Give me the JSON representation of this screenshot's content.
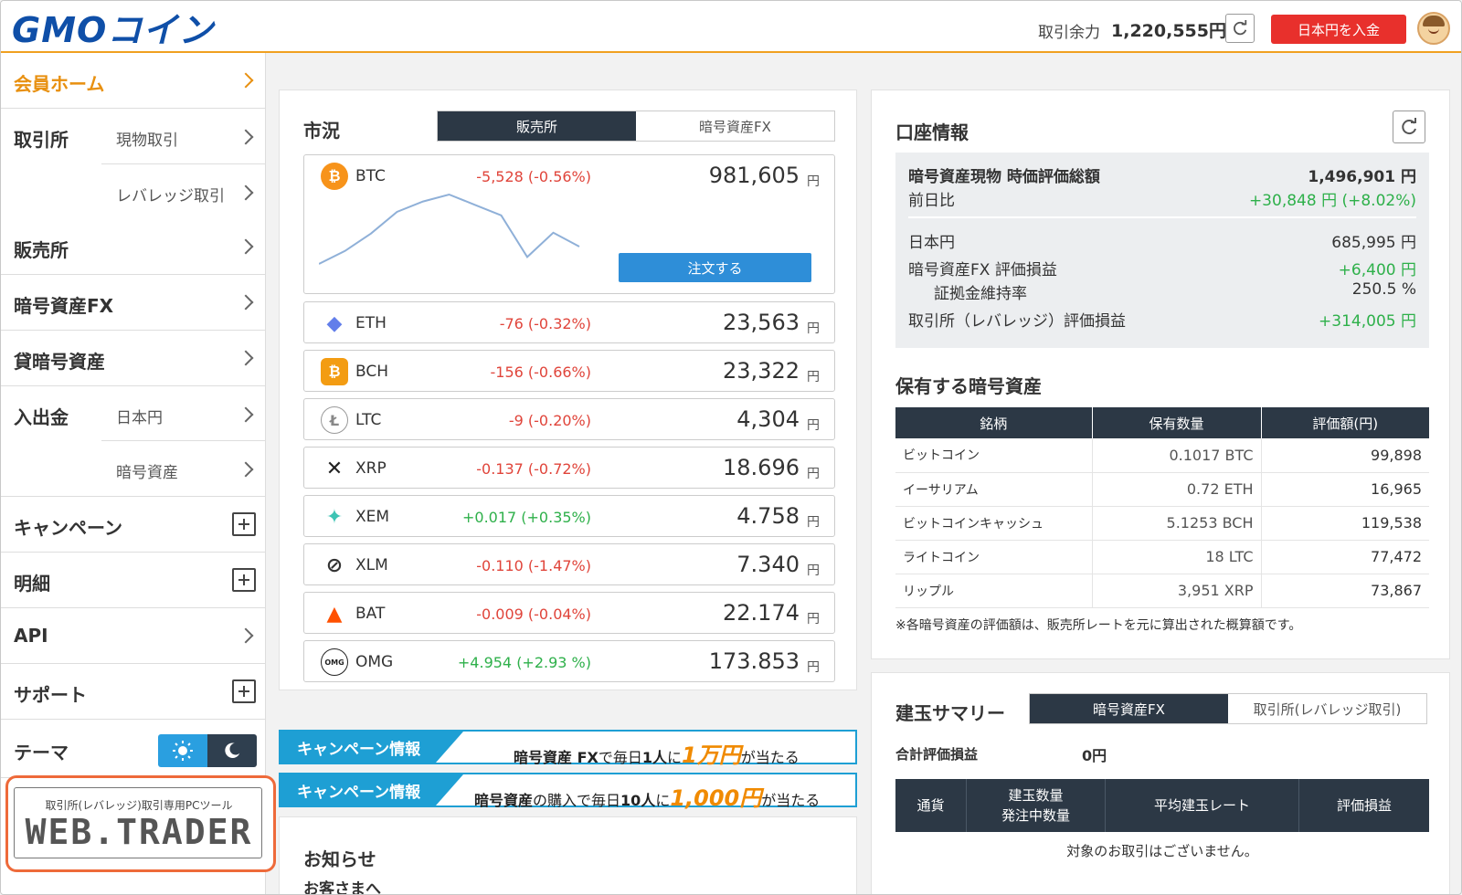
{
  "header": {
    "logo": "GMOコイン",
    "balance_label": "取引余力",
    "balance_value": "1,220,555円",
    "deposit_button": "日本円を入金",
    "accent": "#f0a020",
    "deposit_color": "#e8302c"
  },
  "sidebar": {
    "home": "会員ホーム",
    "exchange": {
      "title": "取引所",
      "sub1": "現物取引",
      "sub2": "レバレッジ取引"
    },
    "dealer": "販売所",
    "fx": "暗号資産FX",
    "lending": "貸暗号資産",
    "transfer": {
      "title": "入出金",
      "sub1": "日本円",
      "sub2": "暗号資産"
    },
    "campaign": "キャンペーン",
    "statement": "明細",
    "api": "API",
    "support": "サポート",
    "theme": "テーマ",
    "webtrader_caption": "取引所(レバレッジ)取引専用PCツール",
    "webtrader_logo": "WEB.TRADER"
  },
  "market": {
    "title": "市況",
    "tab_active": "販売所",
    "tab_other": "暗号資産FX",
    "order_button": "注文する",
    "yen": "円",
    "btc_chart": [
      0.2,
      0.35,
      0.55,
      0.8,
      0.92,
      1.0,
      0.88,
      0.76,
      0.28,
      0.56,
      0.4
    ],
    "coins": [
      {
        "sym": "BTC",
        "change": "-5,528 (-0.56%)",
        "dir": "neg",
        "price": "981,605",
        "icon_color": "#f7931a",
        "icon": "₿"
      },
      {
        "sym": "ETH",
        "change": "-76 (-0.32%)",
        "dir": "neg",
        "price": "23,563",
        "icon_color": "#627eea",
        "icon": "◆"
      },
      {
        "sym": "BCH",
        "change": "-156 (-0.66%)",
        "dir": "neg",
        "price": "23,322",
        "icon_color": "#f39c12",
        "icon": "₿"
      },
      {
        "sym": "LTC",
        "change": "-9 (-0.20%)",
        "dir": "neg",
        "price": "4,304",
        "icon_color": "#a0a0a0",
        "icon": "Ł"
      },
      {
        "sym": "XRP",
        "change": "-0.137 (-0.72%)",
        "dir": "neg",
        "price": "18.696",
        "icon_color": "#222222",
        "icon": "✕"
      },
      {
        "sym": "XEM",
        "change": "+0.017 (+0.35%)",
        "dir": "pos",
        "price": "4.758",
        "icon_color": "#3ec4b4",
        "icon": "✦"
      },
      {
        "sym": "XLM",
        "change": "-0.110 (-1.47%)",
        "dir": "neg",
        "price": "7.340",
        "icon_color": "#333333",
        "icon": "⊘"
      },
      {
        "sym": "BAT",
        "change": "-0.009 (-0.04%)",
        "dir": "neg",
        "price": "22.174",
        "icon_color": "#ff5000",
        "icon": "▲"
      },
      {
        "sym": "OMG",
        "change": "+4.954 (+2.93 %)",
        "dir": "pos",
        "price": "173.853",
        "icon_color": "#ffffff",
        "icon": "OMG"
      }
    ]
  },
  "banners": [
    {
      "tag": "キャンペーン情報",
      "pre": "暗号資産 FX",
      "mid": "で毎日",
      "count": "1人",
      "ni": "に",
      "amount": "1万円",
      "post": "が当たる"
    },
    {
      "tag": "キャンペーン情報",
      "pre": "暗号資産",
      "mid": "の購入で毎日",
      "count": "10人",
      "ni": "に",
      "amount": "1,000円",
      "post": "が当たる"
    }
  ],
  "news": {
    "title": "お知らせ",
    "item": "お客さまへ"
  },
  "account": {
    "title": "口座情報",
    "total_label": "暗号資産現物 時価評価総額",
    "total_value": "1,496,901 円",
    "dod_label": "前日比",
    "dod_value": "+30,848 円 (+8.02%)",
    "jpy_label": "日本円",
    "jpy_value": "685,995 円",
    "fx_label": "暗号資産FX 評価損益",
    "fx_value": "+6,400 円",
    "margin_label": "証拠金維持率",
    "margin_value": "250.5 %",
    "lev_label": "取引所（レバレッジ）評価損益",
    "lev_value": "+314,005 円"
  },
  "holdings": {
    "title": "保有する暗号資産",
    "headers": [
      "銘柄",
      "保有数量",
      "評価額(円)"
    ],
    "rows": [
      {
        "name": "ビットコイン",
        "qty": "0.1017 BTC",
        "val": "99,898"
      },
      {
        "name": "イーサリアム",
        "qty": "0.72 ETH",
        "val": "16,965"
      },
      {
        "name": "ビットコインキャッシュ",
        "qty": "5.1253 BCH",
        "val": "119,538"
      },
      {
        "name": "ライトコイン",
        "qty": "18 LTC",
        "val": "77,472"
      },
      {
        "name": "リップル",
        "qty": "3,951 XRP",
        "val": "73,867"
      }
    ],
    "note": "※各暗号資産の評価額は、販売所レートを元に算出された概算額です。"
  },
  "summary": {
    "title": "建玉サマリー",
    "tab_active": "暗号資産FX",
    "tab_other": "取引所(レバレッジ取引)",
    "pl_label": "合計評価損益",
    "pl_value": "0円",
    "col1": "通貨",
    "col2a": "建玉数量",
    "col2b": "発注中数量",
    "col3": "平均建玉レート",
    "col4": "評価損益",
    "empty": "対象のお取引はございません。"
  }
}
